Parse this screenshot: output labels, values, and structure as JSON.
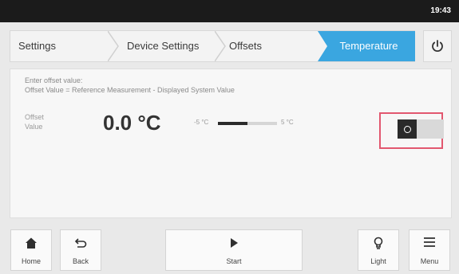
{
  "status_bar": {
    "time": "19:43"
  },
  "breadcrumb": {
    "items": [
      {
        "label": "Settings"
      },
      {
        "label": "Device Settings"
      },
      {
        "label": "Offsets"
      },
      {
        "label": "Temperature",
        "active": true
      }
    ]
  },
  "icons": {
    "power": "power-icon",
    "home": "home-icon",
    "back": "back-arrow-icon",
    "start": "play-icon",
    "light": "lightbulb-icon",
    "menu": "hamburger-menu-icon"
  },
  "panel": {
    "instruction_line1": "Enter offset value:",
    "instruction_line2": "Offset Value = Reference Measurement - Displayed System Value",
    "offset_label_line1": "Offset",
    "offset_label_line2": "Value",
    "offset_value": "0.0 °C",
    "range_min": "-5 °C",
    "range_max": "5 °C",
    "range_fill_fraction": 0.5,
    "toggle_on": false
  },
  "nav": {
    "home": "Home",
    "back": "Back",
    "start": "Start",
    "light": "Light",
    "menu": "Menu"
  },
  "colors": {
    "accent": "#3aa6e0",
    "highlight": "#e2576f",
    "status_bar": "#1b1b1b"
  }
}
